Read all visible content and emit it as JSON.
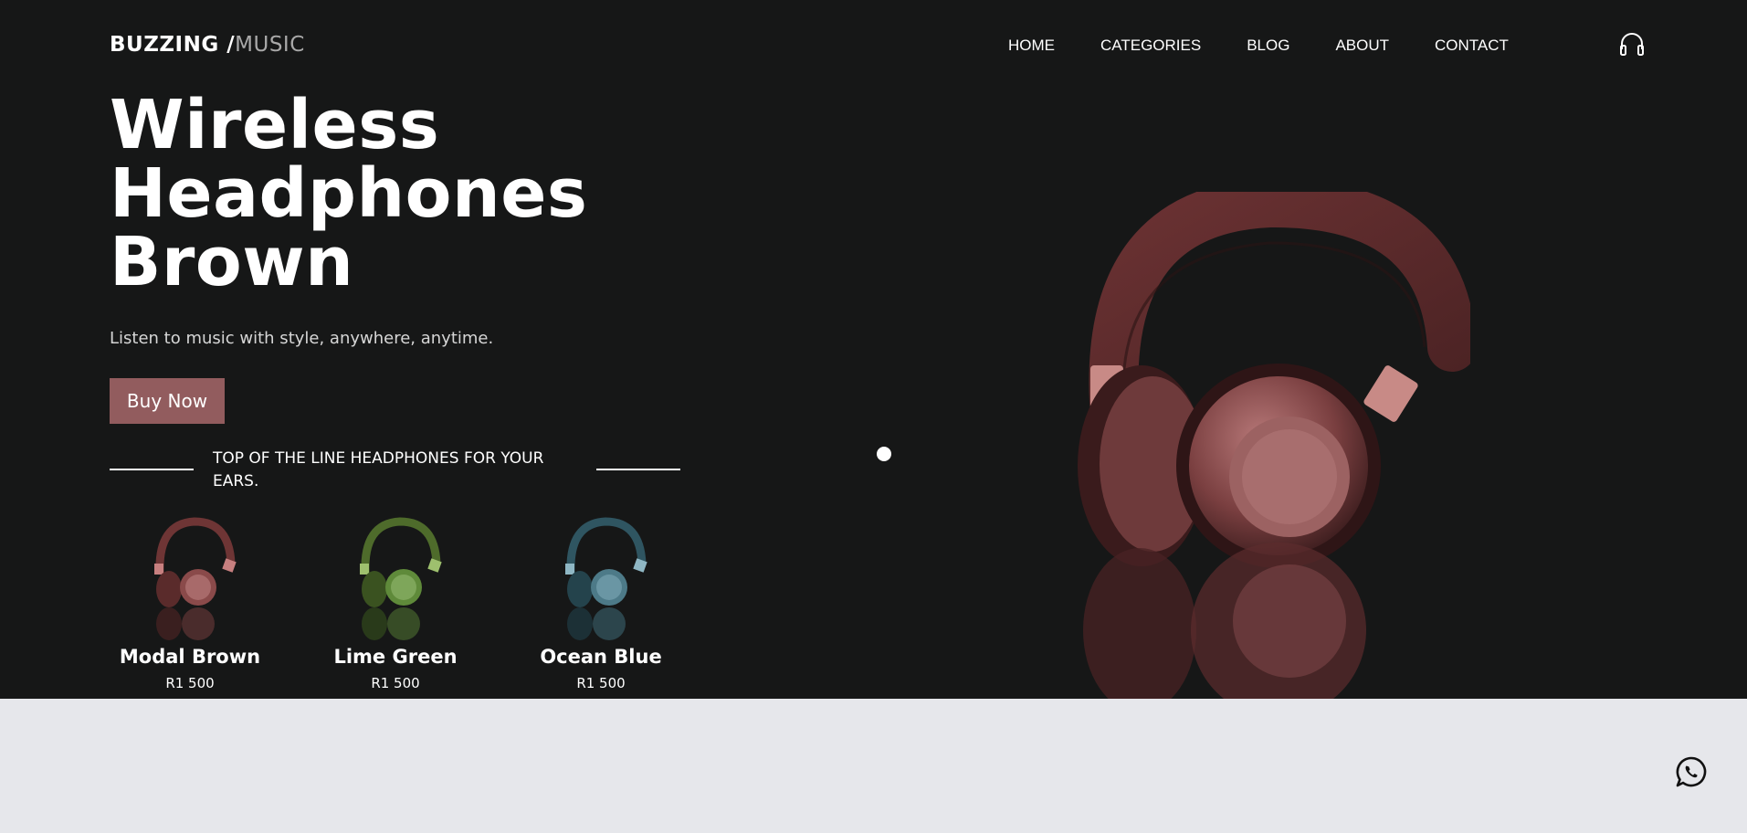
{
  "brand": {
    "part1": "BUZZING /",
    "part2": "MUSIC"
  },
  "nav": [
    {
      "label": "HOME"
    },
    {
      "label": "CATEGORIES"
    },
    {
      "label": "BLOG"
    },
    {
      "label": "ABOUT"
    },
    {
      "label": "CONTACT"
    }
  ],
  "header_icon": "headphones-icon",
  "hero": {
    "title_lines": [
      "Wireless",
      "Headphones",
      "Brown"
    ],
    "subtitle": "Listen to music with style, anywhere, anytime.",
    "cta_label": "Buy Now",
    "tagline": "TOP OF THE LINE HEADPHONES FOR YOUR EARS."
  },
  "products": [
    {
      "name": "Modal Brown",
      "price": "R1 500",
      "color": "#7a3e3e"
    },
    {
      "name": "Lime Green",
      "price": "R1 500",
      "color": "#5d7a35"
    },
    {
      "name": "Ocean Blue",
      "price": "R1 500",
      "color": "#3d5f6a"
    }
  ],
  "colors": {
    "hero_bg": "#161717",
    "accent": "#925c5e",
    "footer_bg": "#e6e7eb"
  },
  "floating_icon": "whatsapp-icon"
}
